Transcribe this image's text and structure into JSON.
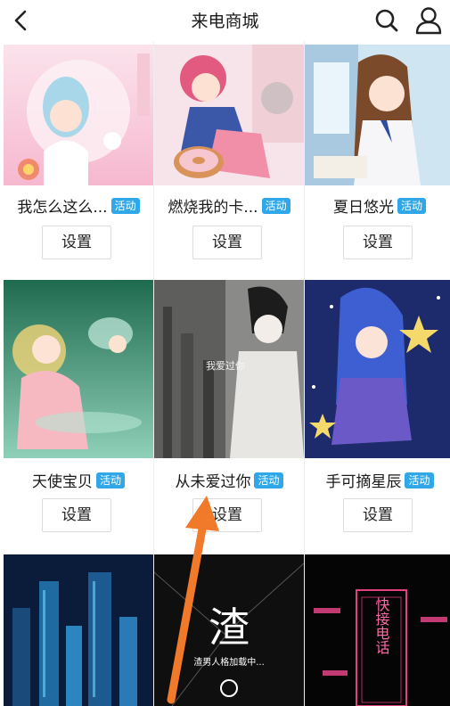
{
  "header": {
    "title": "来电商城"
  },
  "items": [
    {
      "name": "我怎么这么...",
      "badge": "活动",
      "button": "设置"
    },
    {
      "name": "燃烧我的卡...",
      "badge": "活动",
      "button": "设置"
    },
    {
      "name": "夏日悠光",
      "badge": "活动",
      "button": "设置"
    },
    {
      "name": "天使宝贝",
      "badge": "活动",
      "button": "设置"
    },
    {
      "name": "从未爱过你",
      "badge": "活动",
      "button": "设置"
    },
    {
      "name": "手可摘星辰",
      "badge": "活动",
      "button": "设置"
    }
  ],
  "thumb_text": {
    "item5_overlay": "我爱过你",
    "item8_big": "渣",
    "item8_sub": "渣男人格加载中...",
    "item9_vertical": "快接电话"
  },
  "colors": {
    "badge": "#2fa7e8",
    "arrow": "#f07a2a"
  }
}
